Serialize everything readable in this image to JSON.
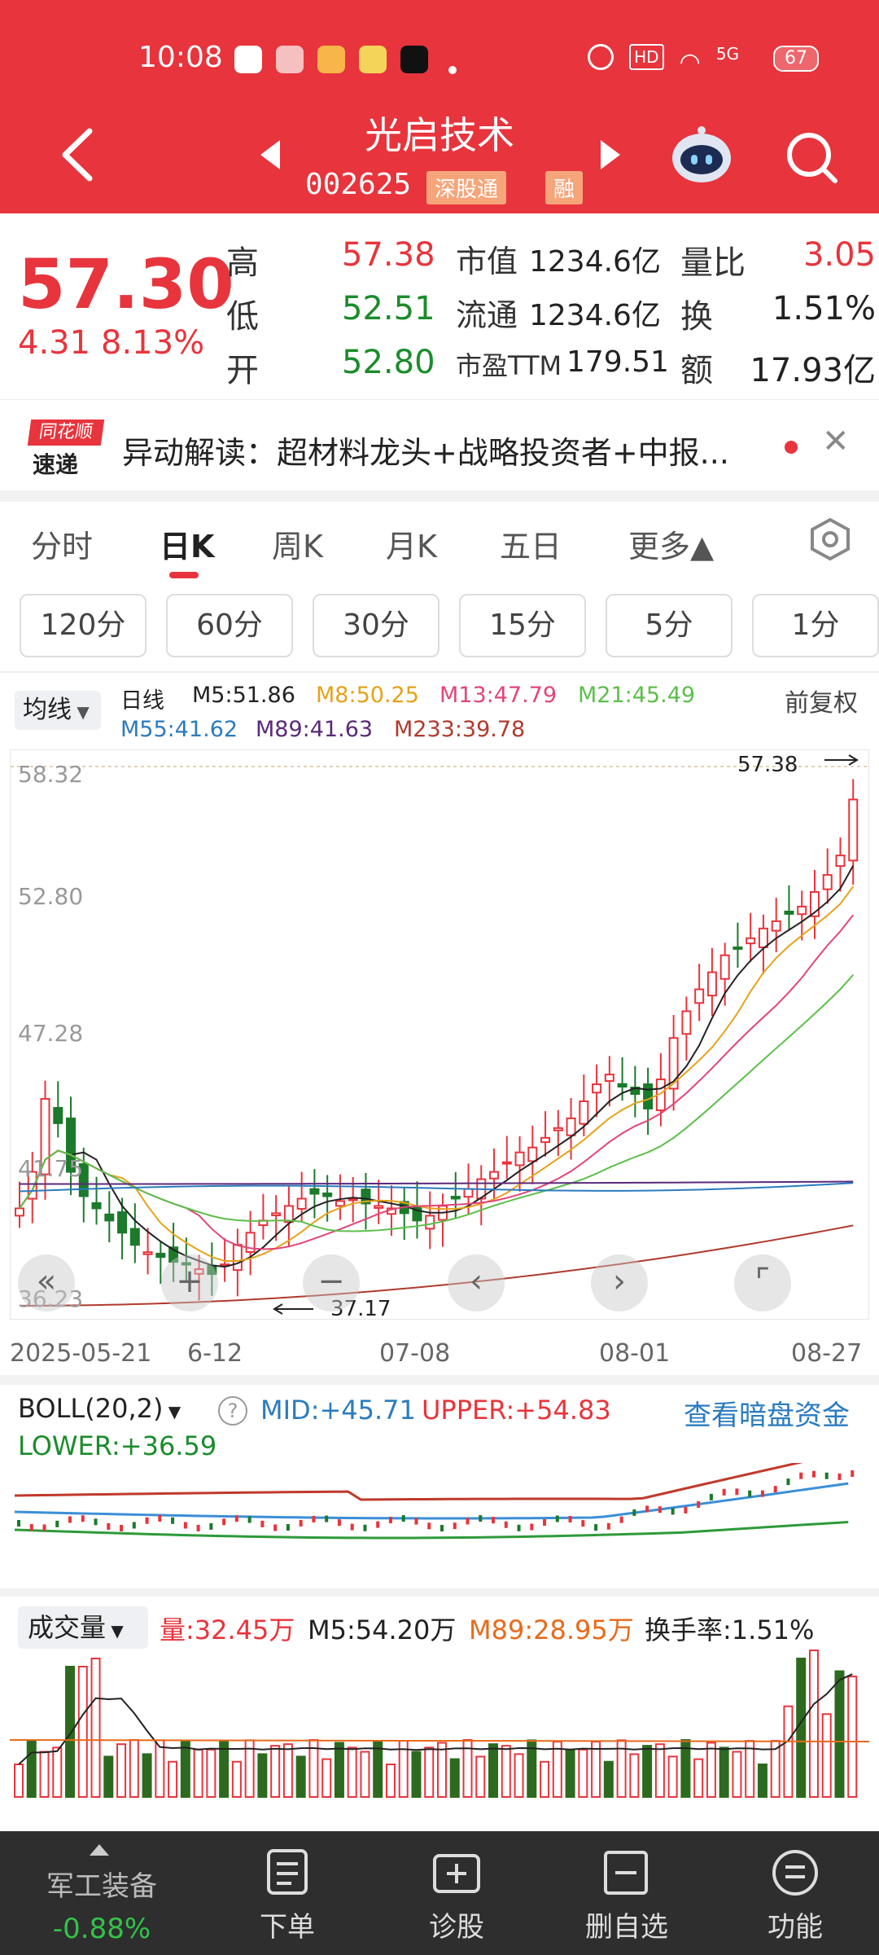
{
  "status_bar": {
    "time": "10:08",
    "battery": "67",
    "signal": "5G"
  },
  "stock": {
    "name": "光启技术",
    "code": "002625",
    "tag1": "深股通",
    "tag2": "融"
  },
  "quote": {
    "price": "57.30",
    "change": "4.31",
    "change_pct": "8.13%",
    "high_label": "高",
    "high": "57.38",
    "low_label": "低",
    "low": "52.51",
    "open_label": "开",
    "open": "52.80",
    "mktcap_label": "市值",
    "mktcap": "1234.6亿",
    "float_label": "流通",
    "float": "1234.6亿",
    "pe_label": "市盈TTM",
    "pe": "179.51",
    "vr_label": "量比",
    "vr": "3.05",
    "turnover_label": "换",
    "turnover": "1.51%",
    "amount_label": "额",
    "amount": "17.93亿"
  },
  "news": {
    "badge_top": "同花顺",
    "badge_bottom": "速递",
    "text": "异动解读：超材料龙头+战略投资者+中报..."
  },
  "tabs": [
    "分时",
    "日K",
    "周K",
    "月K",
    "五日",
    "更多▲"
  ],
  "periods": [
    "120分",
    "60分",
    "30分",
    "15分",
    "5分",
    "1分"
  ],
  "ma": {
    "selector": "均线",
    "kind": "日线",
    "m5": "M5:51.86",
    "m8": "M8:50.25",
    "m13": "M13:47.79",
    "m21": "M21:45.49",
    "m55": "M55:41.62",
    "m89": "M89:41.63",
    "m233": "M233:39.78",
    "adjust": "前复权",
    "colors": {
      "m5": "#222222",
      "m8": "#e6a21a",
      "m13": "#e2457a",
      "m21": "#5cbf4a",
      "m55": "#2b7bbf",
      "m89": "#5a2a7a",
      "m233": "#b03a2e"
    }
  },
  "kline": {
    "y_ticks": [
      "58.32",
      "52.80",
      "47.28",
      "41.75",
      "36.23"
    ],
    "high_marker": "57.38",
    "low_marker": "37.17",
    "dates": [
      "2025-05-21",
      "6-12",
      "07-08",
      "08-01",
      "08-27"
    ]
  },
  "boll": {
    "selector": "BOLL(20,2)",
    "mid": "MID:+45.71",
    "upper": "UPPER:+54.83",
    "lower": "LOWER:+36.59",
    "link": "查看暗盘资金"
  },
  "volume": {
    "selector": "成交量",
    "vol": "量:32.45万",
    "m5": "M5:54.20万",
    "m89": "M89:28.95万",
    "turnover": "换手率:1.51%"
  },
  "bottom": {
    "sector": "军工装备",
    "sector_change": "-0.88%",
    "items": [
      "下单",
      "诊股",
      "删自选",
      "功能"
    ]
  },
  "chart_data": {
    "type": "candlestick",
    "x_start": "2025-05-21",
    "x_end": "08-27",
    "ylim": [
      36.23,
      58.32
    ],
    "last_close": 57.3,
    "period_high": 57.38,
    "period_low": 37.17
  }
}
